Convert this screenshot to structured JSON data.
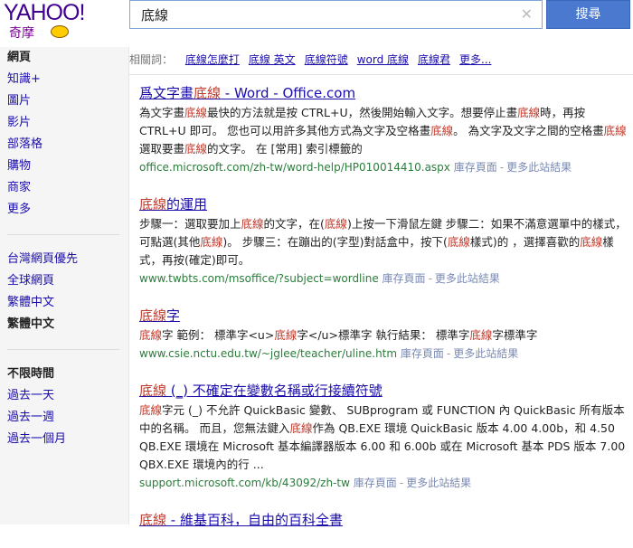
{
  "brand": {
    "logo_text": "YAHOO!",
    "logo_sub": "奇摩"
  },
  "search": {
    "query": "底線",
    "clear_glyph": "✕",
    "button": "搜尋"
  },
  "related": {
    "label": "相關詞：",
    "items": [
      "底線怎麼打",
      "底線 英文",
      "底線符號",
      "word 底線",
      "底線君",
      "更多..."
    ]
  },
  "sidebar": {
    "groups": [
      [
        "網頁",
        "知識+",
        "圖片",
        "影片",
        "部落格",
        "購物",
        "商家",
        "更多"
      ],
      [
        "台灣網頁優先",
        "全球網頁",
        "繁體中文",
        "繁體中文"
      ],
      [
        "不限時間",
        "過去一天",
        "過去一週",
        "過去一個月"
      ]
    ]
  },
  "results": [
    {
      "title": [
        "爲文字畫",
        "底線",
        " - Word - Office.com"
      ],
      "snippet": [
        "為文字畫",
        "底線",
        "最快的方法就是按 CTRL+U，然後開始輸入文字。想要停止畫",
        "底線",
        "時，再按 CTRL+U 即可。 您也可以用許多其他方式為文字及空格畫",
        "底線",
        "。 為文字及文字之間的空格畫",
        "底線",
        " 選取要畫",
        "底線",
        "的文字。 在 [常用] 索引標籤的"
      ],
      "url": "office.microsoft.com/zh-tw/word-help/HP010014410.aspx",
      "cache": "庫存頁面",
      "more": "更多此站結果"
    },
    {
      "title": [
        "",
        "底線",
        "的運用"
      ],
      "snippet": [
        "步驟一：選取要加上",
        "底線",
        "的文字，在(",
        "底線",
        ")上按一下滑鼠左鍵 步驟二：如果不滿意選單中的樣式，可點選(其他",
        "底線",
        ")。 步驟三：在蹦出的(字型)對話盒中，按下(",
        "底線",
        "樣式)的 ，選擇喜歡的",
        "底線",
        "樣式，再按(確定)即可。"
      ],
      "url": "www.twbts.com/msoffice/?subject=wordline",
      "cache": "庫存頁面",
      "more": "更多此站結果"
    },
    {
      "title": [
        "",
        "底線",
        "字"
      ],
      "snippet": [
        "",
        "底線",
        "字 範例： 標準字<u>",
        "底線",
        "字</u>標準字 執行結果： 標準字",
        "底線",
        "字標準字"
      ],
      "url": "www.csie.nctu.edu.tw/~jglee/teacher/uline.htm",
      "cache": "庫存頁面",
      "more": "更多此站結果"
    },
    {
      "title": [
        "",
        "底線",
        " (_) 不確定在變數名稱或行接續符號"
      ],
      "snippet": [
        "",
        "底線",
        "字元 (_) 不允許 QuickBasic 變數、 SUBprogram 或 FUNCTION 內 QuickBasic 所有版本中的名稱。 而且，您無法鍵入",
        "底線",
        "作為 QB.EXE 環境 QuickBasic 版本 4.00 4.00b，和 4.50 QB.EXE 環境在 Microsoft 基本編譯器版本 6.00 和 6.00b 或在 Microsoft 基本 PDS 版本 7.00 QBX.EXE 環境內的行 ..."
      ],
      "url": "support.microsoft.com/kb/43092/zh-tw",
      "cache": "庫存頁面",
      "more": "更多此站結果"
    },
    {
      "title": [
        "",
        "底線",
        " - 維基百科，自由的百科全書"
      ],
      "snippet": [],
      "url": "",
      "cache": "",
      "more": ""
    }
  ]
}
